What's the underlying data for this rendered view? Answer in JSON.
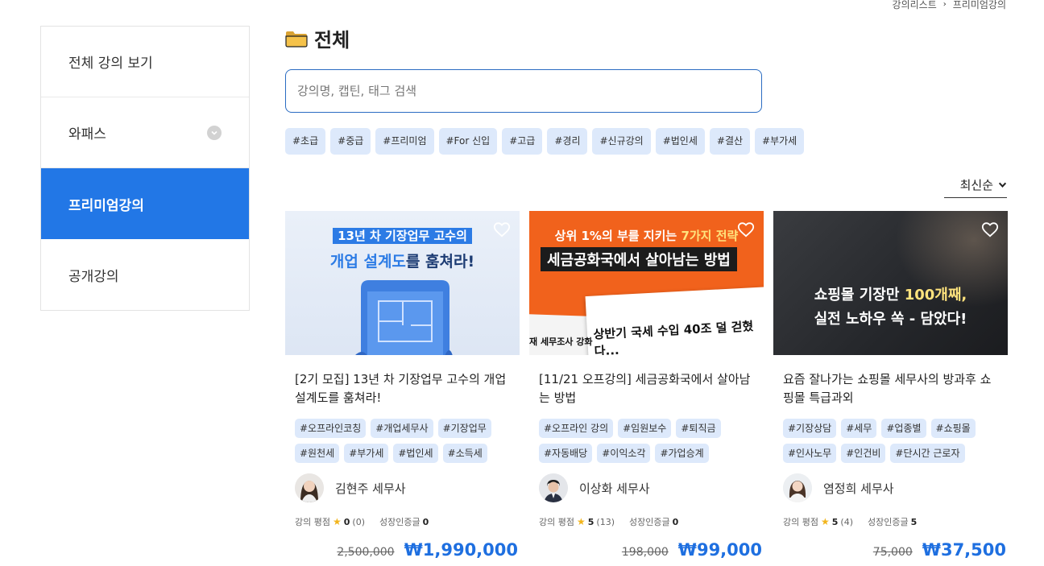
{
  "breadcrumb": [
    "강의리스트",
    "프리미엄강의"
  ],
  "sidebar": {
    "items": [
      {
        "label": "전체 강의 보기"
      },
      {
        "label": "와패스"
      },
      {
        "label": "프리미엄강의"
      },
      {
        "label": "공개강의"
      }
    ]
  },
  "header": {
    "title": "전체",
    "icon": "folder-icon"
  },
  "search": {
    "placeholder": "강의명, 캡틴, 태그 검색",
    "value": ""
  },
  "filter_tags": [
    "#초급",
    "#중급",
    "#프리미엄",
    "#For 신입",
    "#고급",
    "#경리",
    "#신규강의",
    "#법인세",
    "#결산",
    "#부가세"
  ],
  "sort": {
    "selected": "최신순"
  },
  "cards": [
    {
      "thumb": {
        "line1": "13년 차 기장업무 고수의",
        "line2_hl": "개업 설계도",
        "line2_rest": "를 훔쳐라!"
      },
      "title": "[2기 모집] 13년 차 기장업무 고수의 개업 설계도를 훔쳐라!",
      "tags": [
        "#오프라인코칭",
        "#개업세무사",
        "#기장업무",
        "#원천세",
        "#부가세",
        "#법인세",
        "#소득세"
      ],
      "author": "김현주 세무사",
      "rating_label": "강의 평점",
      "rating": "0",
      "rating_count": "(0)",
      "cert_label": "성장인증글",
      "cert": "0",
      "orig_price": "2,500,000",
      "price": "₩1,990,000"
    },
    {
      "thumb": {
        "line1_pre": "상위 1%의 부를 지키는 ",
        "line1_hl": "7가지 전략",
        "line2": "세금공화국에서 살아남는 방법",
        "paper": "상반기 국세 수입 40조 덜 걷혔다...",
        "paper2": "재 세무조사 강화"
      },
      "title": "[11/21 오프강의] 세금공화국에서 살아남는 방법",
      "tags": [
        "#오프라인 강의",
        "#임원보수",
        "#퇴직금",
        "#자동배당",
        "#이익소각",
        "#가업승계"
      ],
      "author": "이상화 세무사",
      "rating_label": "강의 평점",
      "rating": "5",
      "rating_count": "(13)",
      "cert_label": "성장인증글",
      "cert": "0",
      "orig_price": "198,000",
      "price": "₩99,000"
    },
    {
      "thumb": {
        "line1_pre": "쇼핑몰 기장만 ",
        "line1_hl": "100개째,",
        "line2": "실전 노하우 쏙 - 담았다!"
      },
      "title": "요즘 잘나가는 쇼핑몰 세무사의 방과후 쇼핑몰 특급과외",
      "tags": [
        "#기장상담",
        "#세무",
        "#업종별",
        "#쇼핑몰",
        "#인사노무",
        "#인건비",
        "#단시간 근로자"
      ],
      "author": "염정희 세무사",
      "rating_label": "강의 평점",
      "rating": "5",
      "rating_count": "(4)",
      "cert_label": "성장인증글",
      "cert": "5",
      "orig_price": "75,000",
      "price": "₩37,500"
    }
  ],
  "colors": {
    "accent": "#2277e6",
    "tag_bg": "#dde9fb",
    "price": "#1e6fe0",
    "star": "#f2b51d"
  }
}
